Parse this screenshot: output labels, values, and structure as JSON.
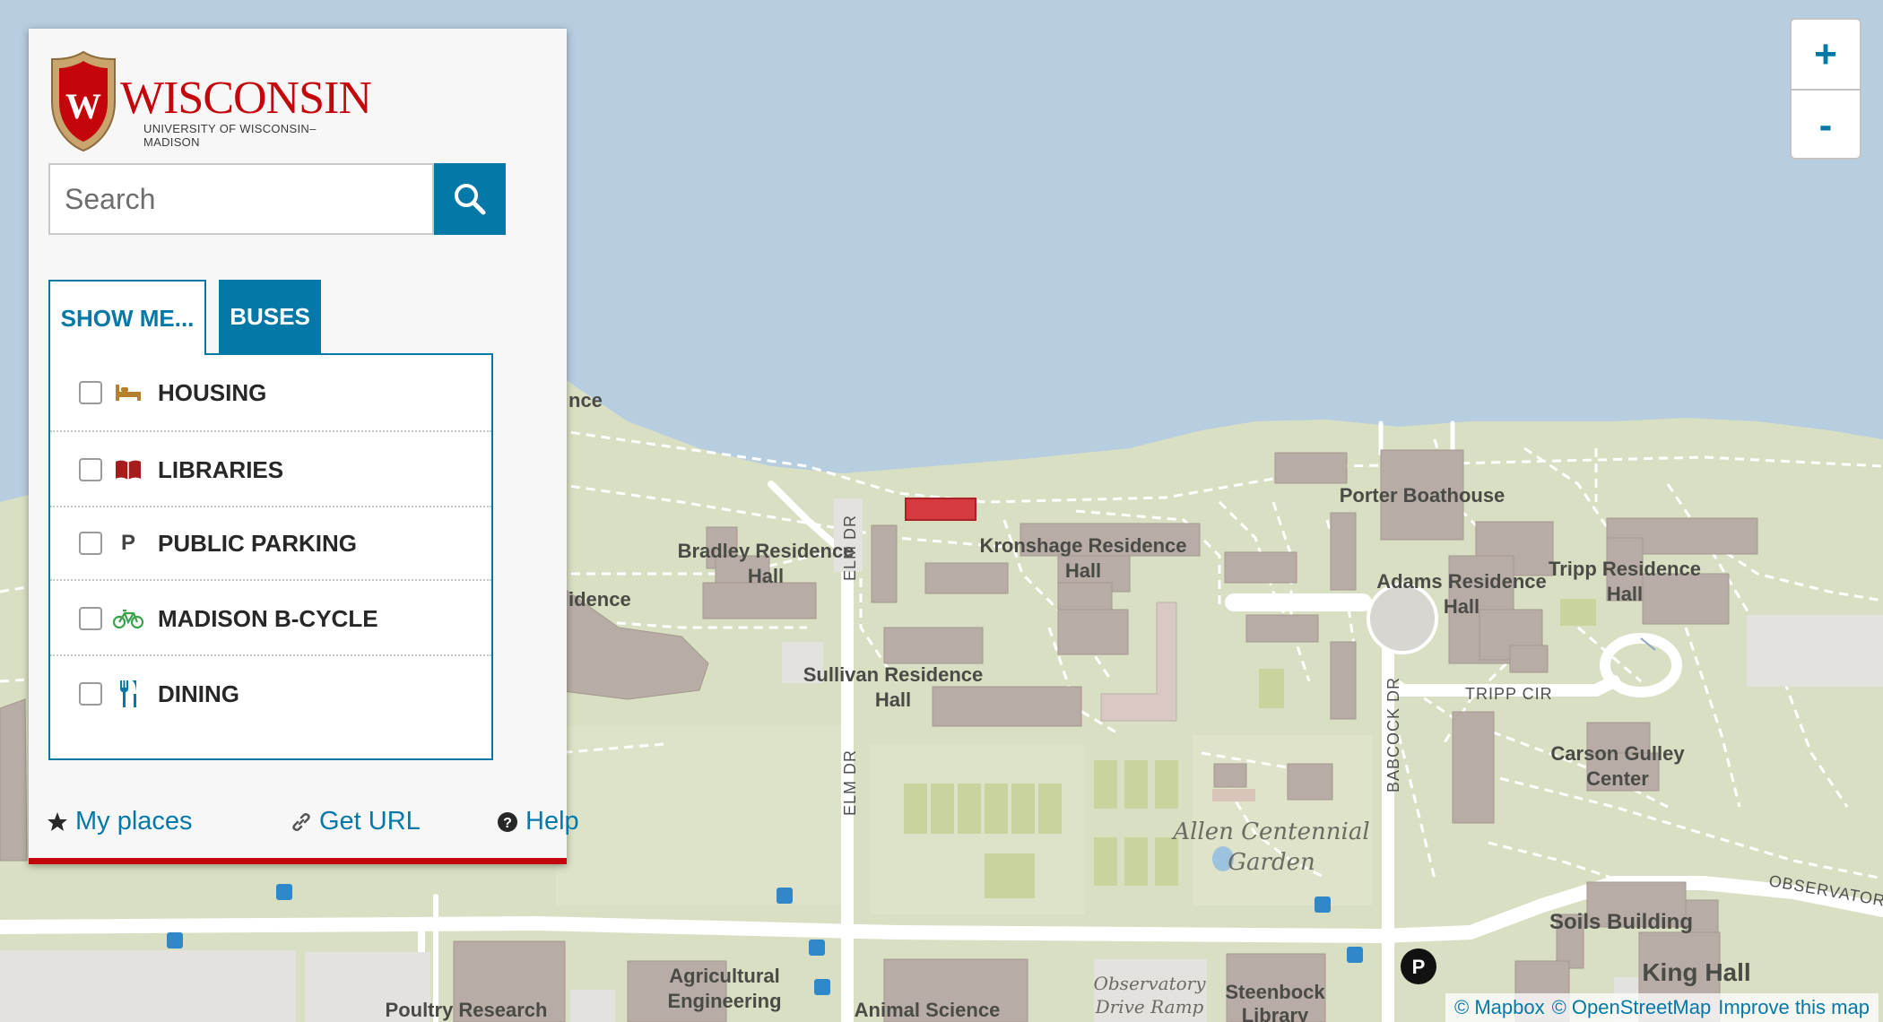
{
  "panel": {
    "logo": {
      "wordmark": "WISCONSIN",
      "subtitle": "UNIVERSITY OF WISCONSIN–MADISON",
      "shield_letter": "W"
    },
    "search": {
      "placeholder": "Search"
    },
    "tabs": [
      {
        "label": "SHOW ME..."
      },
      {
        "label": "BUSES"
      }
    ],
    "layers": [
      {
        "label": "HOUSING",
        "icon": "bed-icon",
        "color": "#b5802c"
      },
      {
        "label": "LIBRARIES",
        "icon": "book-icon",
        "color": "#a51c1c"
      },
      {
        "label": "PUBLIC PARKING",
        "icon": "parking-p-icon",
        "icon_text": "P",
        "color": "#444444"
      },
      {
        "label": "MADISON B-CYCLE",
        "icon": "bicycle-icon",
        "color": "#3aa34a"
      },
      {
        "label": "DINING",
        "icon": "fork-knife-icon",
        "color": "#0479a8"
      }
    ],
    "footer": {
      "my_places": "My places",
      "get_url": "Get URL",
      "help": "Help"
    }
  },
  "zoom": {
    "in": "+",
    "out": "-"
  },
  "attribution": {
    "mapbox": "© Mapbox",
    "osm": "© OpenStreetMap",
    "improve": "Improve this map"
  },
  "map": {
    "labels": {
      "porter": "Porter Boathouse",
      "bradley1": "Bradley Residence",
      "bradley2": "Hall",
      "kronshage1": "Kronshage Residence",
      "kronshage2": "Hall",
      "adams1": "Adams Residence",
      "adams2": "Hall",
      "tripp1": "Tripp Residence",
      "tripp2": "Hall",
      "sullivan1": "Sullivan Residence",
      "sullivan2": "Hall",
      "carson1": "Carson Gulley",
      "carson2": "Center",
      "allen1": "Allen Centennial",
      "allen2": "Garden",
      "soils": "Soils Building",
      "king": "King Hall",
      "agri1": "Agricultural",
      "agri2": "Engineering",
      "animal": "Animal Science",
      "steenbock1": "Steenbock",
      "steenbock2": "Library",
      "poultry": "Poultry Research",
      "obs1": "Observatory",
      "obs2": "Drive Ramp",
      "frag_nce": "nce",
      "frag_idence": "idence"
    },
    "roads": {
      "elm_upper": "ELM DR",
      "elm_lower": "ELM DR",
      "babcock": "BABCOCK DR",
      "tripp_cir": "TRIPP CIR",
      "observatory": "OBSERVATORY"
    },
    "parking_marker": "P",
    "colors": {
      "water": "#b7cde0",
      "land": "#d9dfc2",
      "building": "#b8ada6",
      "highlight": "#d53a3f"
    }
  }
}
